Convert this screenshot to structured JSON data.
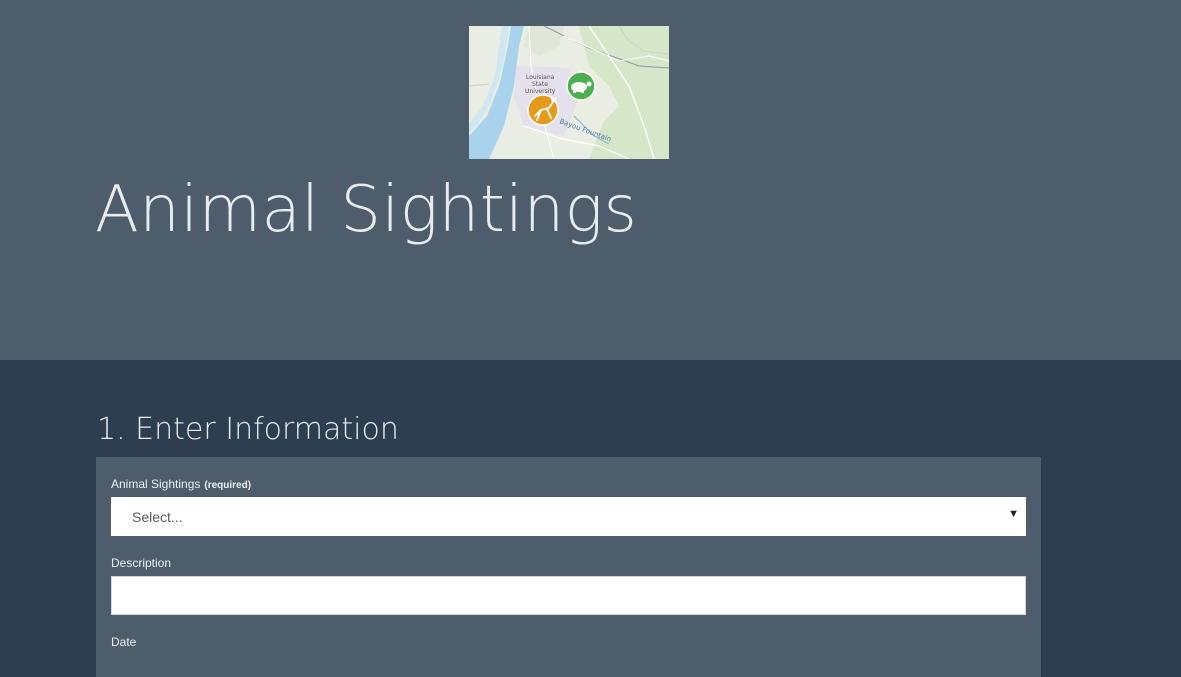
{
  "header": {
    "title": "Animal Sightings",
    "map_thumbnail": {
      "labels": {
        "university": [
          "Louisiana",
          "State",
          "University"
        ],
        "water": "Bayou Fountain"
      },
      "icons": [
        "deer-icon",
        "turtle-icon"
      ]
    }
  },
  "form": {
    "section_title": "1. Enter Information",
    "fields": {
      "sightings": {
        "label": "Animal Sightings",
        "required": "(required)",
        "value": "Select..."
      },
      "description": {
        "label": "Description",
        "value": ""
      },
      "date": {
        "label": "Date"
      }
    }
  },
  "colors": {
    "header_bg": "#4d5d6c",
    "page_bg": "#2c3e50",
    "panel_bg": "#4d5d6c",
    "deer_marker": "#e69a1a",
    "turtle_marker": "#4caf50"
  }
}
